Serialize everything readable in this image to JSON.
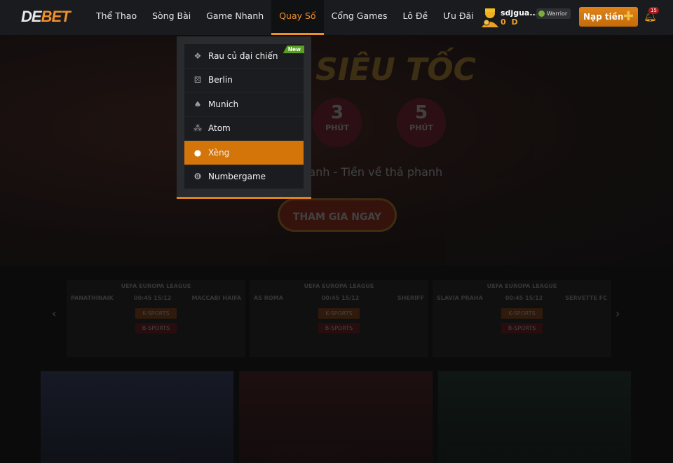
{
  "brand": {
    "logo_a": "DE",
    "logo_b": "BET"
  },
  "nav": [
    {
      "label": "Thể Thao"
    },
    {
      "label": "Sòng Bài"
    },
    {
      "label": "Game Nhanh"
    },
    {
      "label": "Quay Số",
      "active": true
    },
    {
      "label": "Cổng Games"
    },
    {
      "label": "Lô Đề"
    },
    {
      "label": "Ưu Đãi"
    }
  ],
  "user": {
    "name": "sdjgua...",
    "balance": "0 D",
    "rank": "Warrior",
    "deposit_label": "Nạp tiền",
    "deposit_icon": "plus-icon",
    "notifications": "15"
  },
  "dropdown": {
    "new_badge": "New",
    "items": [
      {
        "label": "Rau củ đại chiến",
        "icon": "vegetable-icon",
        "new": true
      },
      {
        "label": "Berlin",
        "icon": "dice-icon"
      },
      {
        "label": "Munich",
        "icon": "spade-icon"
      },
      {
        "label": "Atom",
        "icon": "atom-icon"
      },
      {
        "label": "Xèng",
        "icon": "apple-icon",
        "active": true
      },
      {
        "label": "Numbergame",
        "icon": "number-8-icon"
      }
    ]
  },
  "hero": {
    "title": "SIÊU TỐC",
    "c1": "3",
    "c2": "5",
    "unit": "PHÚT",
    "slogan": "nhanh - Tiền về thả phanh",
    "cta": "THAM GIA NGAY"
  },
  "matches": [
    {
      "league": "UEFA EUROPA LEAGUE",
      "home": "PANATHINAIK",
      "away": "MACCABI HAIFA",
      "time": "00:45",
      "date": "15/12",
      "odds_a": "K-SPORTS",
      "odds_b": "B-SPORTS"
    },
    {
      "league": "UEFA EUROPA LEAGUE",
      "home": "AS ROMA",
      "away": "SHERIFF",
      "time": "00:45",
      "date": "15/12",
      "odds_a": "K-SPORTS",
      "odds_b": "B-SPORTS"
    },
    {
      "league": "UEFA EUROPA LEAGUE",
      "home": "SLAVIA PRAHA",
      "away": "SERVETTE FC",
      "time": "00:45",
      "date": "15/12",
      "odds_a": "K-SPORTS",
      "odds_b": "B-SPORTS"
    }
  ],
  "colors": {
    "accent": "#e08318",
    "header": "#1a1b1e",
    "new_badge": "#5aa020"
  }
}
